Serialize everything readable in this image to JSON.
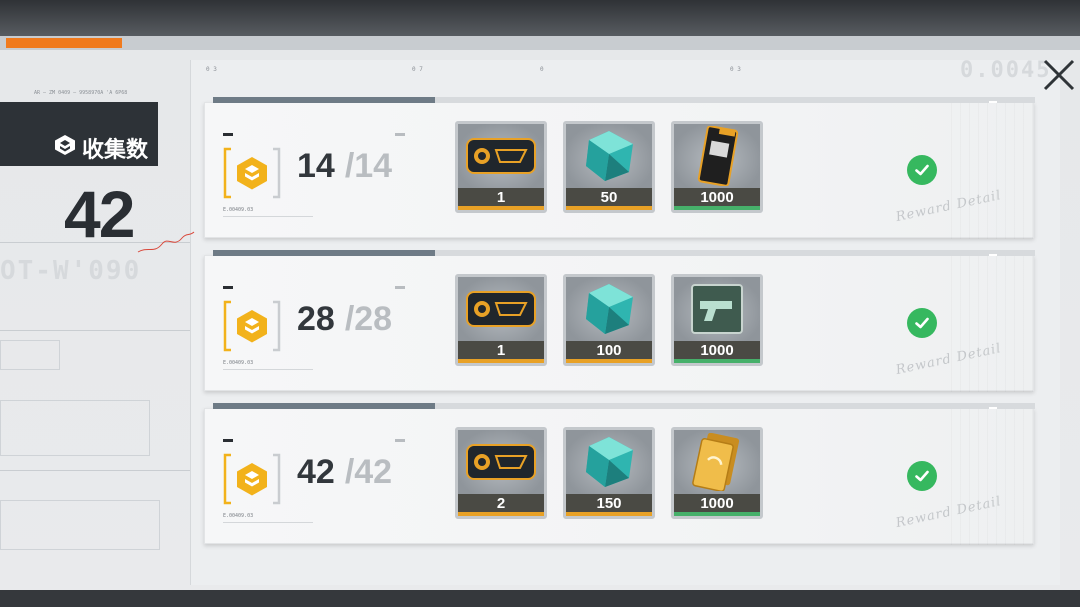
{
  "collection": {
    "label": "收集数",
    "count": "42",
    "meta_code": "AR — ZM 0409 — 9958970A 'A 6P68",
    "icon": "collection-icon"
  },
  "close": {
    "icon": "close-icon"
  },
  "background": {
    "faint_code_left": "OT-W'090",
    "faint_code_right": "0.0045",
    "ticks": [
      "0 3",
      "0 7",
      "0",
      "0 3"
    ]
  },
  "rows": [
    {
      "progress_current": "14",
      "progress_total": "/14",
      "code": "E.00409.03",
      "signature": "Reward Detail",
      "claimed": true,
      "rewards": [
        {
          "icon": "chip-card-icon",
          "qty": "1",
          "rarity_color": "#e8a126"
        },
        {
          "icon": "crystal-icon",
          "qty": "50",
          "rarity_color": "#e8a126"
        },
        {
          "icon": "credit-card-pack-icon",
          "qty": "1000",
          "rarity_color": "#46b06a"
        }
      ]
    },
    {
      "progress_current": "28",
      "progress_total": "/28",
      "code": "E.00409.03",
      "signature": "Reward Detail",
      "claimed": true,
      "rewards": [
        {
          "icon": "chip-card-icon",
          "qty": "1",
          "rarity_color": "#e8a126"
        },
        {
          "icon": "crystal-icon",
          "qty": "100",
          "rarity_color": "#e8a126"
        },
        {
          "icon": "weapon-blueprint-icon",
          "qty": "1000",
          "rarity_color": "#46b06a"
        }
      ]
    },
    {
      "progress_current": "42",
      "progress_total": "/42",
      "code": "E.00409.03",
      "signature": "Reward Detail",
      "claimed": true,
      "rewards": [
        {
          "icon": "chip-card-icon",
          "qty": "2",
          "rarity_color": "#e8a126"
        },
        {
          "icon": "crystal-icon",
          "qty": "150",
          "rarity_color": "#e8a126"
        },
        {
          "icon": "gold-bar-icon",
          "qty": "1000",
          "rarity_color": "#46b06a"
        }
      ]
    }
  ],
  "colors": {
    "accent_orange": "#f07a1d",
    "claimed_green": "#36b85f",
    "currency_yellow": "#f2b21b",
    "dark_header": "#2d3237"
  }
}
